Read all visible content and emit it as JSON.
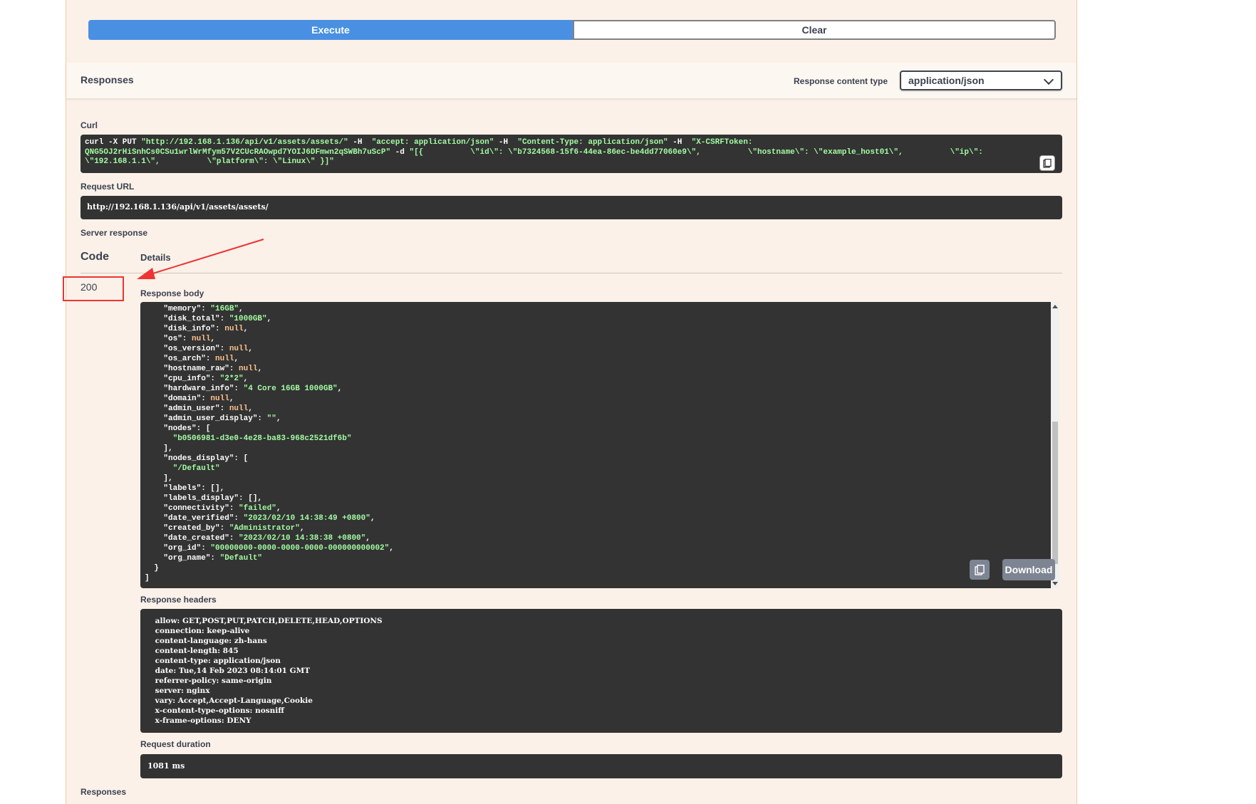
{
  "execute_label": "Execute",
  "clear_label": "Clear",
  "responses_title": "Responses",
  "response_content_type_label": "Response content type",
  "response_content_type_value": "application/json",
  "curl_label": "Curl",
  "curl_lines": {
    "l1a": "curl -X PUT ",
    "l1b": "\"http://192.168.1.136/api/v1/assets/assets/\"",
    "l1c": " -H  ",
    "l1d": "\"accept: application/json\"",
    "l1e": " -H  ",
    "l1f": "\"Content-Type: application/json\"",
    "l1g": " -H  ",
    "l1h": "\"X-CSRFToken:",
    "l2a": "QNG5OJ2rHiSnhCs0CSu1wrlWrMfym57V2CUcRAOwpd7YOIJ6DFmwn2qSWBh7uScP\"",
    "l2b": " -d ",
    "l2c": "\"[{          \\\"id\\\": \\\"b7324568-15f6-44ea-86ec-be4dd77060e9\\\",          \\\"hostname\\\": \\\"example_host01\\\",          \\\"ip\\\":",
    "l3a": "\\\"192.168.1.1\\\",          \\\"platform\\\": \\\"Linux\\\" }]\""
  },
  "request_url_label": "Request URL",
  "request_url": "http://192.168.1.136/api/v1/assets/assets/",
  "server_response_label": "Server response",
  "code_header": "Code",
  "details_header": "Details",
  "response_code": "200",
  "response_body_label": "Response body",
  "response_body_lines": [
    {
      "k": "    \"memory\"",
      "v": "\"16GB\"",
      "t": "s",
      "e": ","
    },
    {
      "k": "    \"disk_total\"",
      "v": "\"1000GB\"",
      "t": "s",
      "e": ","
    },
    {
      "k": "    \"disk_info\"",
      "v": "null",
      "t": "n",
      "e": ","
    },
    {
      "k": "    \"os\"",
      "v": "null",
      "t": "n",
      "e": ","
    },
    {
      "k": "    \"os_version\"",
      "v": "null",
      "t": "n",
      "e": ","
    },
    {
      "k": "    \"os_arch\"",
      "v": "null",
      "t": "n",
      "e": ","
    },
    {
      "k": "    \"hostname_raw\"",
      "v": "null",
      "t": "n",
      "e": ","
    },
    {
      "k": "    \"cpu_info\"",
      "v": "\"2*2\"",
      "t": "s",
      "e": ","
    },
    {
      "k": "    \"hardware_info\"",
      "v": "\"4 Core 16GB 1000GB\"",
      "t": "s",
      "e": ","
    },
    {
      "k": "    \"domain\"",
      "v": "null",
      "t": "n",
      "e": ","
    },
    {
      "k": "    \"admin_user\"",
      "v": "null",
      "t": "n",
      "e": ","
    },
    {
      "k": "    \"admin_user_display\"",
      "v": "\"\"",
      "t": "s",
      "e": ","
    },
    {
      "k": "    \"nodes\"",
      "v": "",
      "t": "p",
      "e": "["
    },
    {
      "k": "",
      "v": "      \"b0506981-d3e0-4e28-ba83-968c2521df6b\"",
      "t": "r",
      "e": ""
    },
    {
      "k": "",
      "v": "    ],",
      "t": "x",
      "e": ""
    },
    {
      "k": "    \"nodes_display\"",
      "v": "",
      "t": "p",
      "e": "["
    },
    {
      "k": "",
      "v": "      \"/Default\"",
      "t": "r",
      "e": ""
    },
    {
      "k": "",
      "v": "    ],",
      "t": "x",
      "e": ""
    },
    {
      "k": "    \"labels\"",
      "v": "",
      "t": "p",
      "e": "[],"
    },
    {
      "k": "    \"labels_display\"",
      "v": "",
      "t": "p",
      "e": "[],"
    },
    {
      "k": "    \"connectivity\"",
      "v": "\"failed\"",
      "t": "s",
      "e": ","
    },
    {
      "k": "    \"date_verified\"",
      "v": "\"2023/02/10 14:38:49 +0800\"",
      "t": "s",
      "e": ","
    },
    {
      "k": "    \"created_by\"",
      "v": "\"Administrator\"",
      "t": "s",
      "e": ","
    },
    {
      "k": "    \"date_created\"",
      "v": "\"2023/02/10 14:38:38 +0800\"",
      "t": "s",
      "e": ","
    },
    {
      "k": "    \"org_id\"",
      "v": "\"00000000-0000-0000-0000-000000000002\"",
      "t": "s",
      "e": ","
    },
    {
      "k": "    \"org_name\"",
      "v": "\"Default\"",
      "t": "s",
      "e": ""
    },
    {
      "k": "",
      "v": "  }",
      "t": "x",
      "e": ""
    },
    {
      "k": "",
      "v": "]",
      "t": "x",
      "e": ""
    }
  ],
  "download_label": "Download",
  "response_headers_label": "Response headers",
  "response_headers_lines": [
    " allow: GET,POST,PUT,PATCH,DELETE,HEAD,OPTIONS ",
    " connection: keep-alive ",
    " content-language: zh-hans ",
    " content-length: 845 ",
    " content-type: application/json ",
    " date: Tue,14 Feb 2023 08:14:01 GMT ",
    " referrer-policy: same-origin ",
    " server: nginx ",
    " vary: Accept,Accept-Language,Cookie ",
    " x-content-type-options: nosniff ",
    " x-frame-options: DENY "
  ],
  "request_duration_label": "Request duration",
  "request_duration": "1081 ms",
  "responses_footer": "Responses"
}
